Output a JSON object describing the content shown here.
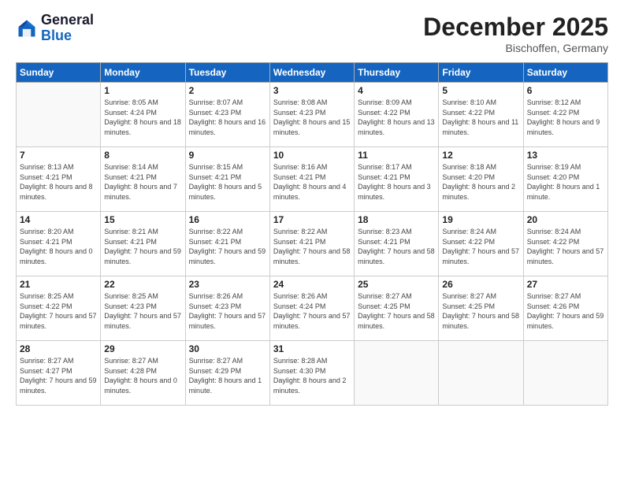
{
  "header": {
    "logo_line1": "General",
    "logo_line2": "Blue",
    "month_year": "December 2025",
    "location": "Bischoffen, Germany"
  },
  "weekdays": [
    "Sunday",
    "Monday",
    "Tuesday",
    "Wednesday",
    "Thursday",
    "Friday",
    "Saturday"
  ],
  "weeks": [
    [
      {
        "day": "",
        "info": ""
      },
      {
        "day": "1",
        "info": "Sunrise: 8:05 AM\nSunset: 4:24 PM\nDaylight: 8 hours\nand 18 minutes."
      },
      {
        "day": "2",
        "info": "Sunrise: 8:07 AM\nSunset: 4:23 PM\nDaylight: 8 hours\nand 16 minutes."
      },
      {
        "day": "3",
        "info": "Sunrise: 8:08 AM\nSunset: 4:23 PM\nDaylight: 8 hours\nand 15 minutes."
      },
      {
        "day": "4",
        "info": "Sunrise: 8:09 AM\nSunset: 4:22 PM\nDaylight: 8 hours\nand 13 minutes."
      },
      {
        "day": "5",
        "info": "Sunrise: 8:10 AM\nSunset: 4:22 PM\nDaylight: 8 hours\nand 11 minutes."
      },
      {
        "day": "6",
        "info": "Sunrise: 8:12 AM\nSunset: 4:22 PM\nDaylight: 8 hours\nand 9 minutes."
      }
    ],
    [
      {
        "day": "7",
        "info": "Sunrise: 8:13 AM\nSunset: 4:21 PM\nDaylight: 8 hours\nand 8 minutes."
      },
      {
        "day": "8",
        "info": "Sunrise: 8:14 AM\nSunset: 4:21 PM\nDaylight: 8 hours\nand 7 minutes."
      },
      {
        "day": "9",
        "info": "Sunrise: 8:15 AM\nSunset: 4:21 PM\nDaylight: 8 hours\nand 5 minutes."
      },
      {
        "day": "10",
        "info": "Sunrise: 8:16 AM\nSunset: 4:21 PM\nDaylight: 8 hours\nand 4 minutes."
      },
      {
        "day": "11",
        "info": "Sunrise: 8:17 AM\nSunset: 4:21 PM\nDaylight: 8 hours\nand 3 minutes."
      },
      {
        "day": "12",
        "info": "Sunrise: 8:18 AM\nSunset: 4:20 PM\nDaylight: 8 hours\nand 2 minutes."
      },
      {
        "day": "13",
        "info": "Sunrise: 8:19 AM\nSunset: 4:20 PM\nDaylight: 8 hours\nand 1 minute."
      }
    ],
    [
      {
        "day": "14",
        "info": "Sunrise: 8:20 AM\nSunset: 4:21 PM\nDaylight: 8 hours\nand 0 minutes."
      },
      {
        "day": "15",
        "info": "Sunrise: 8:21 AM\nSunset: 4:21 PM\nDaylight: 7 hours\nand 59 minutes."
      },
      {
        "day": "16",
        "info": "Sunrise: 8:22 AM\nSunset: 4:21 PM\nDaylight: 7 hours\nand 59 minutes."
      },
      {
        "day": "17",
        "info": "Sunrise: 8:22 AM\nSunset: 4:21 PM\nDaylight: 7 hours\nand 58 minutes."
      },
      {
        "day": "18",
        "info": "Sunrise: 8:23 AM\nSunset: 4:21 PM\nDaylight: 7 hours\nand 58 minutes."
      },
      {
        "day": "19",
        "info": "Sunrise: 8:24 AM\nSunset: 4:22 PM\nDaylight: 7 hours\nand 57 minutes."
      },
      {
        "day": "20",
        "info": "Sunrise: 8:24 AM\nSunset: 4:22 PM\nDaylight: 7 hours\nand 57 minutes."
      }
    ],
    [
      {
        "day": "21",
        "info": "Sunrise: 8:25 AM\nSunset: 4:22 PM\nDaylight: 7 hours\nand 57 minutes."
      },
      {
        "day": "22",
        "info": "Sunrise: 8:25 AM\nSunset: 4:23 PM\nDaylight: 7 hours\nand 57 minutes."
      },
      {
        "day": "23",
        "info": "Sunrise: 8:26 AM\nSunset: 4:23 PM\nDaylight: 7 hours\nand 57 minutes."
      },
      {
        "day": "24",
        "info": "Sunrise: 8:26 AM\nSunset: 4:24 PM\nDaylight: 7 hours\nand 57 minutes."
      },
      {
        "day": "25",
        "info": "Sunrise: 8:27 AM\nSunset: 4:25 PM\nDaylight: 7 hours\nand 58 minutes."
      },
      {
        "day": "26",
        "info": "Sunrise: 8:27 AM\nSunset: 4:25 PM\nDaylight: 7 hours\nand 58 minutes."
      },
      {
        "day": "27",
        "info": "Sunrise: 8:27 AM\nSunset: 4:26 PM\nDaylight: 7 hours\nand 59 minutes."
      }
    ],
    [
      {
        "day": "28",
        "info": "Sunrise: 8:27 AM\nSunset: 4:27 PM\nDaylight: 7 hours\nand 59 minutes."
      },
      {
        "day": "29",
        "info": "Sunrise: 8:27 AM\nSunset: 4:28 PM\nDaylight: 8 hours\nand 0 minutes."
      },
      {
        "day": "30",
        "info": "Sunrise: 8:27 AM\nSunset: 4:29 PM\nDaylight: 8 hours\nand 1 minute."
      },
      {
        "day": "31",
        "info": "Sunrise: 8:28 AM\nSunset: 4:30 PM\nDaylight: 8 hours\nand 2 minutes."
      },
      {
        "day": "",
        "info": ""
      },
      {
        "day": "",
        "info": ""
      },
      {
        "day": "",
        "info": ""
      }
    ]
  ]
}
